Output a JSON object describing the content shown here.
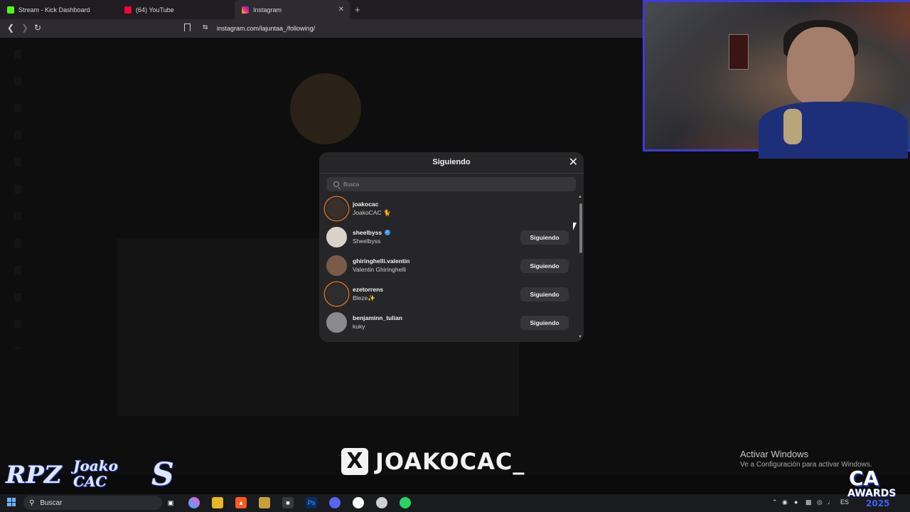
{
  "browser": {
    "tabs": [
      {
        "label": "Stream - Kick Dashboard",
        "favicon_color": "#53fc18"
      },
      {
        "label": "(64) YouTube",
        "favicon_color": "#ff0033"
      },
      {
        "label": "Instagram",
        "favicon_color": "#e1306c"
      }
    ],
    "new_tab": "+",
    "tab_close": "✕",
    "url": "instagram.com/lajuntaa_/following/"
  },
  "modal": {
    "title": "Siguiendo",
    "search_placeholder": "Busca",
    "users": [
      {
        "username": "joakocac",
        "full_name": "JoakoCAC 🐈",
        "verified": false,
        "button": "",
        "avatar_color": "#3a2f2a",
        "ring": true
      },
      {
        "username": "sheelbyss",
        "full_name": "Sheelbyss",
        "verified": true,
        "button": "Siguiendo",
        "avatar_color": "#d9d2c8",
        "ring": false
      },
      {
        "username": "ghiringhelli.valentin",
        "full_name": "Valentin Ghiringhelli",
        "verified": false,
        "button": "Siguiendo",
        "avatar_color": "#7a5a48",
        "ring": false
      },
      {
        "username": "ezetorrens",
        "full_name": "Bleze✨",
        "verified": false,
        "button": "Siguiendo",
        "avatar_color": "#2e2e30",
        "ring": true
      },
      {
        "username": "benjaminn_tulian",
        "full_name": "kuky",
        "verified": false,
        "button": "Siguiendo",
        "avatar_color": "#8a8a8c",
        "ring": false
      }
    ]
  },
  "overlay": {
    "brand_x": "X",
    "brand_handle": "JOAKOCAC_",
    "activate_title": "Activar Windows",
    "activate_sub": "Ve a Configuración para activar Windows.",
    "logos": [
      "RPZ",
      "Joako CAC",
      "S"
    ],
    "awards_ca": "CA",
    "awards_word": "AWARDS",
    "awards_year": "2025"
  },
  "taskbar": {
    "search_label": "Buscar",
    "lang": "ES"
  },
  "colors": {
    "modal_bg": "#262628",
    "button_bg": "#363639",
    "verified": "#3897f0",
    "webcam_border": "#3e3ad8"
  }
}
